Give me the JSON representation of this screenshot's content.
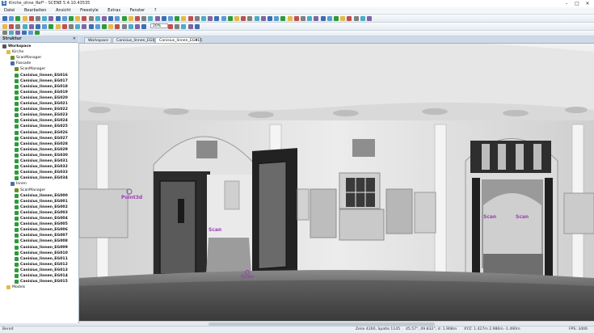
{
  "window": {
    "title": "Kirche_ohne_Ref* - SCENE 5.4.10.43535",
    "app_icon": "S",
    "controls": [
      "–",
      "□",
      "✕"
    ]
  },
  "menu": [
    "Datei",
    "Bearbeiten",
    "Ansicht",
    "Freestyle",
    "Extras",
    "Fenster",
    "?"
  ],
  "toolbar": {
    "zoom_value": "20%"
  },
  "panel": {
    "title": "Struktur",
    "close": "✕"
  },
  "tree": [
    {
      "label": "Workspace",
      "level": 0,
      "icon": "workspace-icon",
      "color": "#555",
      "bold": true
    },
    {
      "label": "Kirche",
      "level": 1,
      "icon": "folder-icon",
      "color": "#e6b84a",
      "bold": false
    },
    {
      "label": "ScanManager",
      "level": 2,
      "icon": "scanmanager-icon",
      "color": "#6b8e23",
      "bold": false
    },
    {
      "label": "Fassade",
      "level": 2,
      "icon": "cluster-icon",
      "color": "#4a6fa5",
      "bold": false
    },
    {
      "label": "ScanManager",
      "level": 3,
      "icon": "scanmanager-icon",
      "color": "#6b8e23",
      "bold": false
    },
    {
      "label": "Canisius_linnen_EG016",
      "level": 3,
      "icon": "scan-icon",
      "color": "#2e9b3a",
      "bold": true
    },
    {
      "label": "Canisius_linnen_EG017",
      "level": 3,
      "icon": "scan-icon",
      "color": "#2e9b3a",
      "bold": true
    },
    {
      "label": "Canisius_linnen_EG018",
      "level": 3,
      "icon": "scan-icon",
      "color": "#2e9b3a",
      "bold": true
    },
    {
      "label": "Canisius_linnen_EG019",
      "level": 3,
      "icon": "scan-icon",
      "color": "#2e9b3a",
      "bold": true
    },
    {
      "label": "Canisius_linnen_EG020",
      "level": 3,
      "icon": "scan-icon",
      "color": "#2e9b3a",
      "bold": true
    },
    {
      "label": "Canisius_linnen_EG021",
      "level": 3,
      "icon": "scan-icon",
      "color": "#2e9b3a",
      "bold": true
    },
    {
      "label": "Canisius_linnen_EG022",
      "level": 3,
      "icon": "scan-icon",
      "color": "#2e9b3a",
      "bold": true
    },
    {
      "label": "Canisius_linnen_EG023",
      "level": 3,
      "icon": "scan-icon",
      "color": "#2e9b3a",
      "bold": true
    },
    {
      "label": "Canisius_linnen_EG024",
      "level": 3,
      "icon": "scan-icon",
      "color": "#2e9b3a",
      "bold": true
    },
    {
      "label": "Canisius_linnen_EG025",
      "level": 3,
      "icon": "scan-icon",
      "color": "#2e9b3a",
      "bold": true
    },
    {
      "label": "Canisius_linnen_EG026",
      "level": 3,
      "icon": "scan-icon",
      "color": "#2e9b3a",
      "bold": true
    },
    {
      "label": "Canisius_linnen_EG027",
      "level": 3,
      "icon": "scan-icon",
      "color": "#2e9b3a",
      "bold": true
    },
    {
      "label": "Canisius_linnen_EG028",
      "level": 3,
      "icon": "scan-icon",
      "color": "#2e9b3a",
      "bold": true
    },
    {
      "label": "Canisius_linnen_EG029",
      "level": 3,
      "icon": "scan-icon",
      "color": "#2e9b3a",
      "bold": true
    },
    {
      "label": "Canisius_linnen_EG030",
      "level": 3,
      "icon": "scan-icon",
      "color": "#2e9b3a",
      "bold": true
    },
    {
      "label": "Canisius_linnen_EG031",
      "level": 3,
      "icon": "scan-icon",
      "color": "#2e9b3a",
      "bold": true
    },
    {
      "label": "Canisius_linnen_EG032",
      "level": 3,
      "icon": "scan-icon",
      "color": "#2e9b3a",
      "bold": true
    },
    {
      "label": "Canisius_linnen_EG033",
      "level": 3,
      "icon": "scan-icon",
      "color": "#2e9b3a",
      "bold": true
    },
    {
      "label": "Canisius_linnen_EG034",
      "level": 3,
      "icon": "scan-icon",
      "color": "#2e9b3a",
      "bold": true
    },
    {
      "label": "Innen",
      "level": 2,
      "icon": "cluster-icon",
      "color": "#4a6fa5",
      "bold": false
    },
    {
      "label": "ScanManager",
      "level": 3,
      "icon": "scanmanager-icon",
      "color": "#6b8e23",
      "bold": false
    },
    {
      "label": "Canisius_linnen_EG000",
      "level": 3,
      "icon": "scan-icon",
      "color": "#2e9b3a",
      "bold": true
    },
    {
      "label": "Canisius_linnen_EG001",
      "level": 3,
      "icon": "scan-icon",
      "color": "#2e9b3a",
      "bold": true
    },
    {
      "label": "Canisius_linnen_EG002",
      "level": 3,
      "icon": "scan-icon",
      "color": "#2e9b3a",
      "bold": true
    },
    {
      "label": "Canisius_linnen_EG003",
      "level": 3,
      "icon": "scan-icon",
      "color": "#2e9b3a",
      "bold": true
    },
    {
      "label": "Canisius_linnen_EG004",
      "level": 3,
      "icon": "scan-icon",
      "color": "#2e9b3a",
      "bold": true
    },
    {
      "label": "Canisius_linnen_EG005",
      "level": 3,
      "icon": "scan-icon",
      "color": "#2e9b3a",
      "bold": true
    },
    {
      "label": "Canisius_linnen_EG006",
      "level": 3,
      "icon": "scan-icon",
      "color": "#2e9b3a",
      "bold": true
    },
    {
      "label": "Canisius_linnen_EG007",
      "level": 3,
      "icon": "scan-icon",
      "color": "#2e9b3a",
      "bold": true
    },
    {
      "label": "Canisius_linnen_EG008",
      "level": 3,
      "icon": "scan-icon",
      "color": "#2e9b3a",
      "bold": true
    },
    {
      "label": "Canisius_linnen_EG009",
      "level": 3,
      "icon": "scan-icon",
      "color": "#2e9b3a",
      "bold": true
    },
    {
      "label": "Canisius_linnen_EG010",
      "level": 3,
      "icon": "scan-icon",
      "color": "#2e9b3a",
      "bold": true
    },
    {
      "label": "Canisius_linnen_EG011",
      "level": 3,
      "icon": "scan-icon",
      "color": "#2e9b3a",
      "bold": true
    },
    {
      "label": "Canisius_linnen_EG012",
      "level": 3,
      "icon": "scan-icon",
      "color": "#2e9b3a",
      "bold": true
    },
    {
      "label": "Canisius_linnen_EG013",
      "level": 3,
      "icon": "scan-icon",
      "color": "#2e9b3a",
      "bold": true
    },
    {
      "label": "Canisius_linnen_EG014",
      "level": 3,
      "icon": "scan-icon",
      "color": "#2e9b3a",
      "bold": true
    },
    {
      "label": "Canisius_linnen_EG015",
      "level": 3,
      "icon": "scan-icon",
      "color": "#2e9b3a",
      "bold": true
    },
    {
      "label": "Models",
      "level": 1,
      "icon": "folder-icon",
      "color": "#e6b84a",
      "bold": false
    }
  ],
  "tabs": [
    {
      "label": "Workspace",
      "active": false
    },
    {
      "label": "Canisius_linnen_EG016",
      "active": false
    },
    {
      "label": "Canisius_linnen_EG015",
      "active": true
    }
  ],
  "tab_close": "✕",
  "viewport": {
    "point_label": "Point3d",
    "scan_markers": [
      "Scan",
      "Scan",
      "Scan",
      "Scan"
    ]
  },
  "status": {
    "left": "Bereit",
    "position": "Zeile 4260, Spalte 1145",
    "angles": "45.57°, 09.832°, d: 1.908m",
    "coords": "XYZ: 1.427m 2.986m -1.490m",
    "fps": "FPS: 3406"
  },
  "colors": {
    "accent": "#3a6fb5",
    "scan_green": "#2e9b3a",
    "label_purple": "#9b3fb5"
  }
}
